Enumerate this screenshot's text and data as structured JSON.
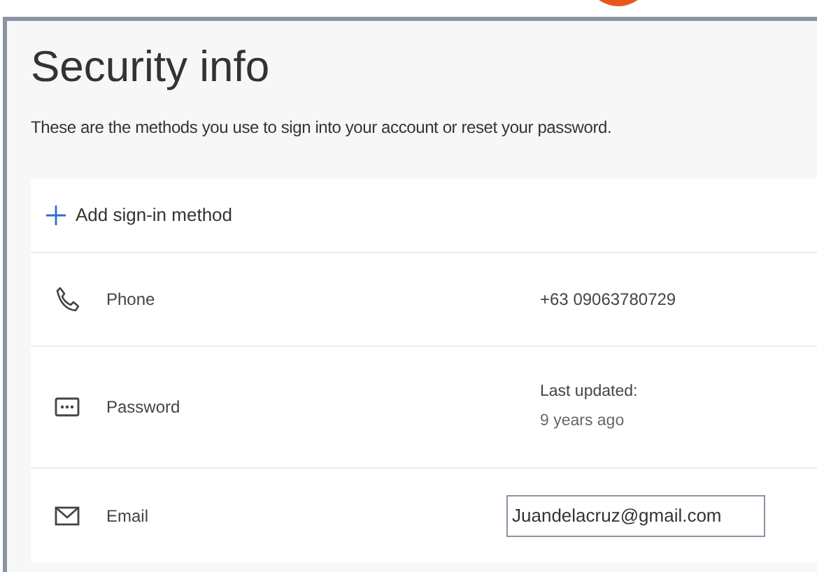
{
  "title": "Security info",
  "description": "These are the methods you use to sign into your account or reset your password.",
  "add_method": {
    "label": "Add sign-in method"
  },
  "methods": [
    {
      "kind": "text",
      "name": "Phone",
      "value": "+63 09063780729"
    },
    {
      "kind": "two_line",
      "name": "Password",
      "value": "Last updated:",
      "detail": "9 years ago"
    },
    {
      "kind": "field",
      "name": "Email",
      "value": "Juandelacruz@gmail.com"
    }
  ]
}
